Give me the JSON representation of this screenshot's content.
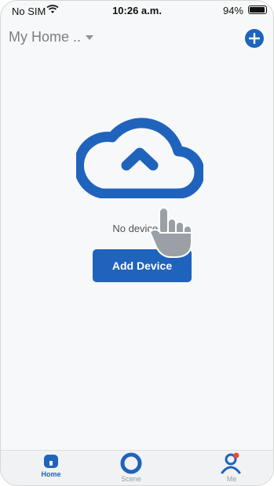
{
  "status_bar": {
    "carrier": "No SIM",
    "time": "10:26 a.m.",
    "battery": "94%"
  },
  "header": {
    "home_name": "My Home .."
  },
  "empty_state": {
    "message": "No devices",
    "add_device_label": "Add Device"
  },
  "tab_bar": {
    "home": "Home",
    "scene": "Scene",
    "me": "Me"
  },
  "colors": {
    "accent": "#1f63bd",
    "badge": "#e74c3c"
  },
  "icons": [
    "wifi-icon",
    "battery-icon",
    "chevron-down-icon",
    "plus-icon",
    "cloud-icon",
    "hand-pointer-icon",
    "home-icon",
    "scene-icon",
    "user-icon"
  ]
}
